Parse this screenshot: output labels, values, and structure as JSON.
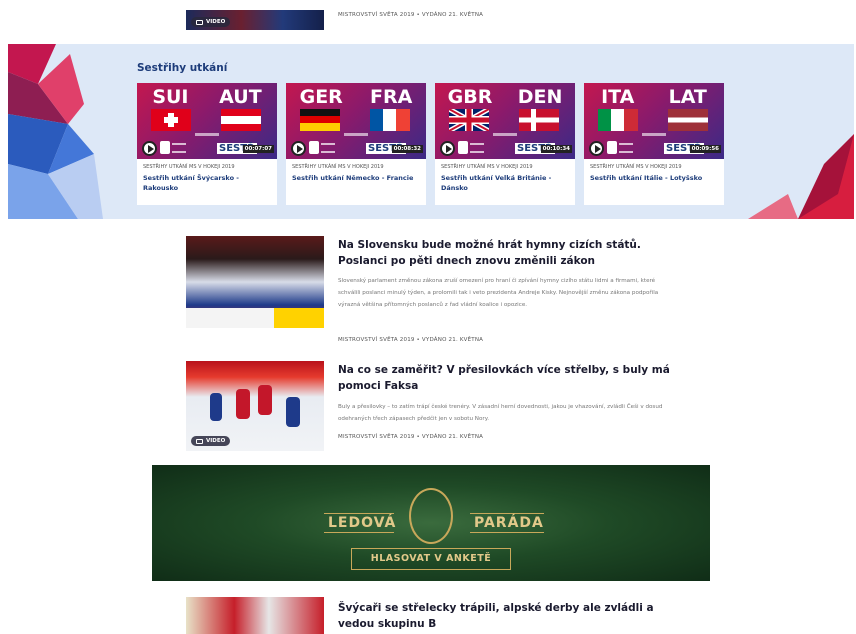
{
  "top_article": {
    "meta": "MISTROVSTVÍ SVĚTA 2019 • VYDÁNO 21. KVĚTNA",
    "badge": "VIDEO"
  },
  "highlights": {
    "title": "Sestřihy utkání",
    "cards": [
      {
        "home": "SUI",
        "away": "AUT",
        "duration": "00:07:07",
        "meta": "SESTŘIHY UTKÁNÍ MS V HOKEJI 2019",
        "title": "Sestřih utkání Švýcarsko - Rakousko"
      },
      {
        "home": "GER",
        "away": "FRA",
        "duration": "00:08:32",
        "meta": "SESTŘIHY UTKÁNÍ MS V HOKEJI 2019",
        "title": "Sestřih utkání Německo - Francie"
      },
      {
        "home": "GBR",
        "away": "DEN",
        "duration": "00:10:34",
        "meta": "SESTŘIHY UTKÁNÍ MS V HOKEJI 2019",
        "title": "Sestřih utkání Velká Británie - Dánsko"
      },
      {
        "home": "ITA",
        "away": "LAT",
        "duration": "00:09:56",
        "meta": "SESTŘIHY UTKÁNÍ MS V HOKEJI 2019",
        "title": "Sestřih utkání Itálie - Lotyšsko"
      }
    ],
    "sestrih_label": "SESTŘ"
  },
  "articles": [
    {
      "title": "Na Slovensku bude možné hrát hymny cizích států. Poslanci po pěti dnech znovu změnili zákon",
      "perex": "Slovenský parlament změnou zákona zruší omezení pro hraní či zpívání hymny cizího státu lidmi a firmami, které schválili poslanci minulý týden, a prolomili tak i veto prezidenta Andreje Kisky. Nejnovější změnu zákona podpořila výrazná většina přítomných poslanců z řad vládní koalice i opozice.",
      "meta": "MISTROVSTVÍ SVĚTA 2019 • VYDÁNO 21. KVĚTNA"
    },
    {
      "title": "Na co se zaměřit? V přesilovkách více střelby, s buly má pomoci Faksa",
      "perex": "Buly a přesilovky – to zatím trápí české trenéry. V zásadní herní dovednosti, jakou je vhazování, zvládli Češi v dosud odehraných třech zápasech předčit jen v sobotu Nory.",
      "meta": "MISTROVSTVÍ SVĚTA 2019 • VYDÁNO 21. KVĚTNA",
      "badge": "VIDEO"
    },
    {
      "title": "Švýcaři se střelecky trápili, alpské derby ale zvládli a vedou skupinu B"
    }
  ],
  "banner": {
    "word_left": "LEDOVÁ",
    "word_right": "PARÁDA",
    "cta": "HLASOVAT V ANKETĚ"
  },
  "colors": {
    "accent": "#1d3c7a",
    "band": "#dde8f7",
    "banner": "#1f4a26",
    "gold": "#e2c98a"
  }
}
